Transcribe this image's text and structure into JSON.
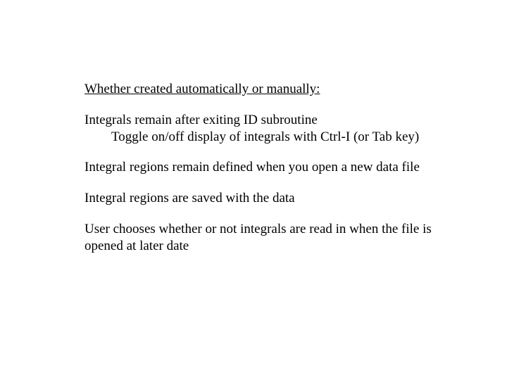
{
  "heading": "Whether created automatically or manually:",
  "p1_line1": "Integrals remain after exiting ID subroutine",
  "p1_line2": "Toggle on/off display of integrals with Ctrl-I (or Tab key)",
  "p2": "Integral regions remain defined when you open a new data file",
  "p3": "Integral regions are saved with the data",
  "p4": "User chooses whether or not integrals are read in when the file is opened at later date"
}
